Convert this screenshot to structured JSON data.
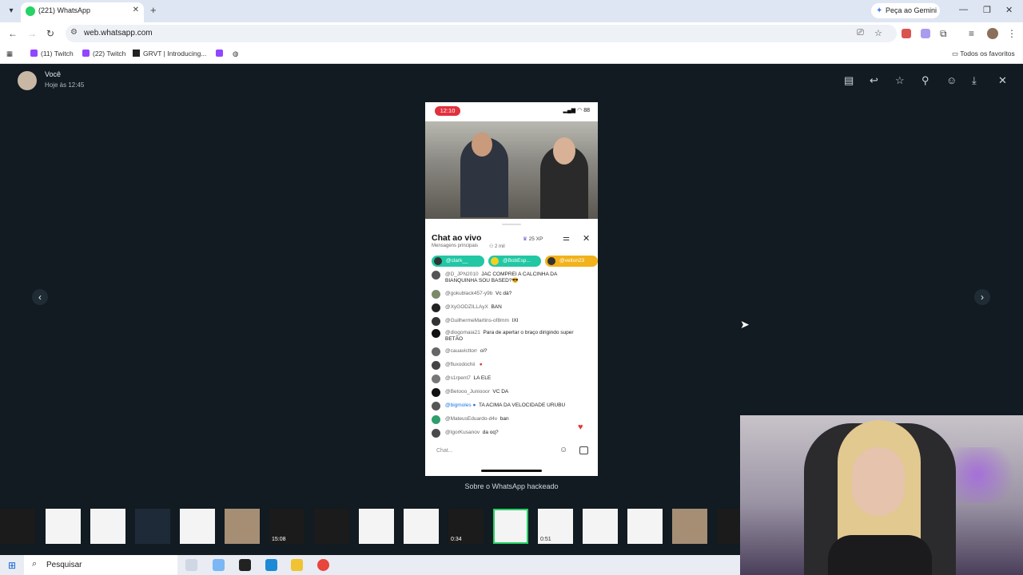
{
  "browser": {
    "tab_title": "(221) WhatsApp",
    "url": "web.whatsapp.com",
    "gemini_label": "Peça ao Gemini",
    "bookmarks": [
      "(11) Twitch",
      "(22) Twitch",
      "GRVT | Introducing..."
    ],
    "favorites_label": "Todos os favoritos"
  },
  "viewer": {
    "sender_name": "Você",
    "sender_time": "Hoje às 12:45",
    "caption": "Sobre o WhatsApp hackeado"
  },
  "phone": {
    "clock": "12:10",
    "battery": "88",
    "chat": {
      "title": "Chat ao vivo",
      "subtitle": "Mensagens principais",
      "viewers": "2 mil",
      "xp": "25 XP",
      "pinned": [
        "@clark__",
        "@BobEsp...",
        "@velton23"
      ],
      "pinned_colors": [
        "#22c7a4",
        "#22c7a4",
        "#f2b21b"
      ],
      "messages": [
        {
          "user": "@D_JPN2010",
          "text": "JAC COMPREI A CALCINHA DA BIANQUINHA SOU BASED?😎"
        },
        {
          "user": "@gokublack457-y9b",
          "text": "Vc dá?"
        },
        {
          "user": "@XyGODZILLAyX",
          "text": "BAN"
        },
        {
          "user": "@GuilhermeMartins-of8mm",
          "text": "IXI"
        },
        {
          "user": "@diogomaia21",
          "text": "Para de apertar o braço dirigindo super BETÃO"
        },
        {
          "user": "@cauavicttorr",
          "text": "oi?"
        },
        {
          "user": "@fluxodochii",
          "text": ""
        },
        {
          "user": "@s1rpent7",
          "text": "LA ELE"
        },
        {
          "user": "@Betooo_Juniooor",
          "text": "VC DA"
        },
        {
          "user": "@bigmoles",
          "text": "TA ACIMA DA VELOCIDADE URUBU"
        },
        {
          "user": "@MateusEduardo-d4v",
          "text": "ban"
        },
        {
          "user": "@IgorKusanov",
          "text": "da oq?"
        }
      ],
      "input_placeholder": "Chat..."
    }
  },
  "thumbnails": {
    "durations": [
      "15:08",
      "0:34",
      "0:51"
    ]
  },
  "taskbar": {
    "search_label": "Pesquisar"
  }
}
